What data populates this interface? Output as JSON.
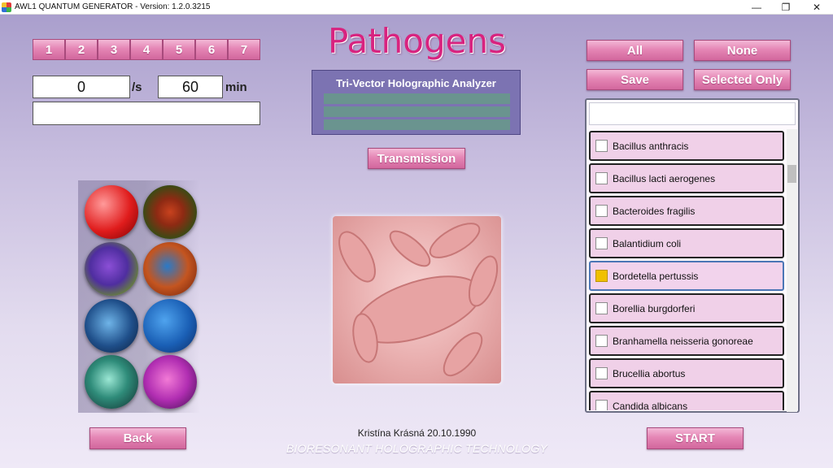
{
  "window": {
    "title": "AWL1 QUANTUM GENERATOR - Version: 1.2.0.3215",
    "minimize": "—",
    "maximize": "❐",
    "close": "✕"
  },
  "page_title": "Pathogens",
  "channels": [
    "1",
    "2",
    "3",
    "4",
    "5",
    "6",
    "7"
  ],
  "timer": {
    "rate_value": "0",
    "rate_unit": "/s",
    "duration_value": "60",
    "duration_unit": "min",
    "status_value": ""
  },
  "analyzer": {
    "label": "Tri-Vector Holographic Analyzer"
  },
  "buttons": {
    "transmission": "Transmission",
    "all": "All",
    "none": "None",
    "save": "Save",
    "selected_only": "Selected Only",
    "back": "Back",
    "start": "START"
  },
  "search": {
    "value": ""
  },
  "pathogens": [
    {
      "name": "Bacillus anthracis",
      "checked": false
    },
    {
      "name": "Bacillus lacti aerogenes",
      "checked": false
    },
    {
      "name": "Bacteroides fragilis",
      "checked": false
    },
    {
      "name": "Balantidium coli",
      "checked": false
    },
    {
      "name": "Bordetella pertussis",
      "checked": true
    },
    {
      "name": "Borellia burgdorferi",
      "checked": false
    },
    {
      "name": "Branhamella neisseria gonoreae",
      "checked": false
    },
    {
      "name": "Brucellia abortus",
      "checked": false
    },
    {
      "name": "Candida albicans",
      "checked": false
    }
  ],
  "footer": {
    "name": "Kristína Krásná 20.10.1990",
    "tagline": "BIORESONANT HOLOGRAPHIC TECHNOLOGY"
  },
  "colors": {
    "title": "#d8237f",
    "button": "#e586b5",
    "analyzer": "#7c73b2",
    "checked": "#f0c000"
  }
}
